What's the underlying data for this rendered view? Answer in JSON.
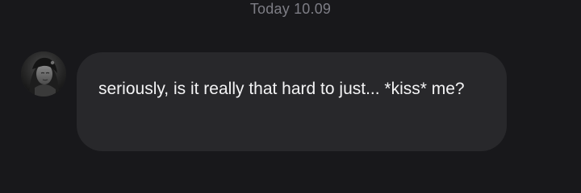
{
  "conversation": {
    "timestamp": "Today 10.09",
    "message": {
      "text": "seriously, is it really that hard to just... *kiss* me?",
      "avatar": "profile-photo"
    }
  },
  "colors": {
    "background": "#18181b",
    "bubble": "#28282b",
    "message_text": "#f4f4f5",
    "timestamp_text": "#7d7d85"
  }
}
